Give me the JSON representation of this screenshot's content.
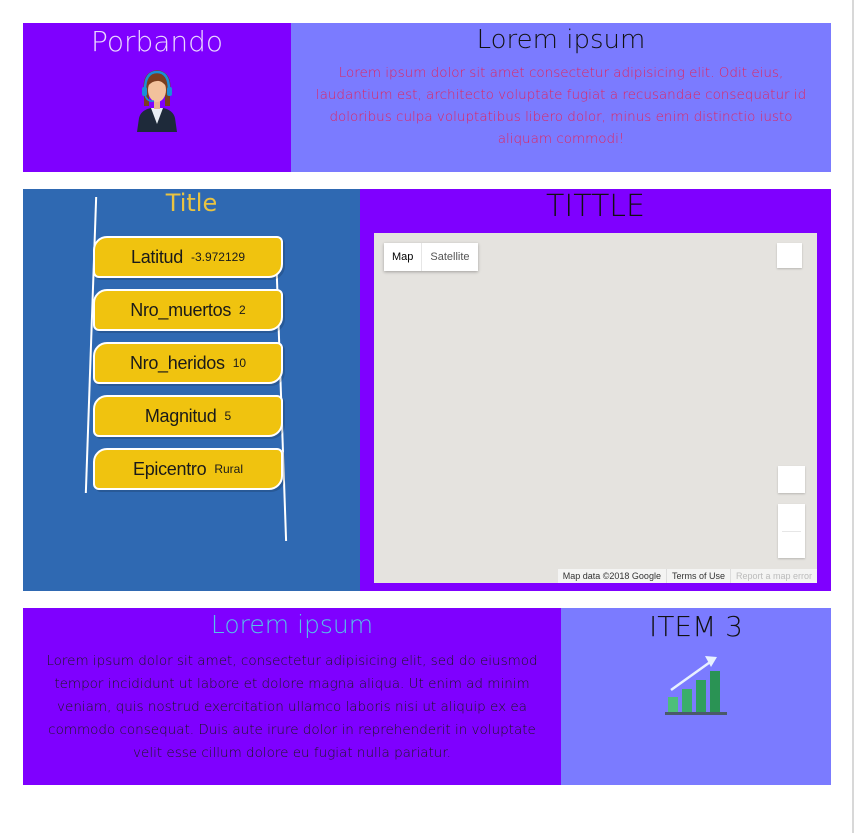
{
  "header_left": {
    "title": "Porbando",
    "avatar_icon": "support-agent-icon"
  },
  "header_right": {
    "title": "Lorem ipsum",
    "body": "Lorem ipsum dolor sit amet consectetur adipisicing elit. Odit eius, laudantium est, architecto voluptate fugiat a recusandae consequatur id doloribus culpa voluptatibus libero dolor, minus enim distinctio iusto aliquam commodi!"
  },
  "info_panel": {
    "title": "Title",
    "items": [
      {
        "label": "Latitud",
        "value": "-3.972129"
      },
      {
        "label": "Nro_muertos",
        "value": "2"
      },
      {
        "label": "Nro_heridos",
        "value": "10"
      },
      {
        "label": "Magnitud",
        "value": "5"
      },
      {
        "label": "Epicentro",
        "value": "Rural"
      }
    ]
  },
  "map_panel": {
    "title": "TITTLE",
    "tab_map": "Map",
    "tab_satellite": "Satellite",
    "map_data": "Map data ©2018 Google",
    "terms": "Terms of Use",
    "report": "Report a map error"
  },
  "footer_left": {
    "title": "Lorem ipsum",
    "body": "Lorem ipsum dolor sit amet, consectetur adipisicing elit, sed do eiusmod tempor incididunt ut labore et dolore magna aliqua. Ut enim ad minim veniam, quis nostrud exercitation ullamco laboris nisi ut aliquip ex ea commodo consequat. Duis aute irure dolor in reprehenderit in voluptate velit esse cillum dolore eu fugiat nulla pariatur."
  },
  "footer_right": {
    "title": "ITEM 3",
    "icon": "growth-chart-icon"
  },
  "colors": {
    "purple": "#7f00ff",
    "periwinkle": "#7b7bff",
    "blue": "#2f69b2",
    "ribbon": "#f0c30f",
    "title_gold": "#e9c341",
    "body_red": "#e0245e",
    "title_cyan": "#55c2e8"
  }
}
